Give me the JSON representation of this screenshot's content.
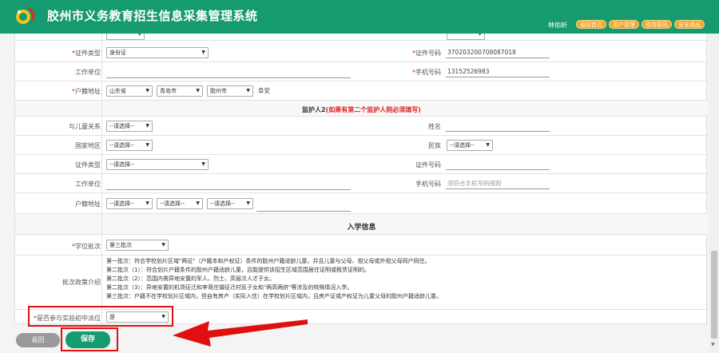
{
  "header": {
    "title": "胶州市义务教育招生信息采集管理系统",
    "user": "林佑昕",
    "links": [
      "返回首页",
      "用户管理",
      "修改密码",
      "安全退出"
    ]
  },
  "guardian1": {
    "row_top": {
      "left_label_partial": "",
      "right_label_partial": "",
      "left_value": "",
      "right_value": ""
    },
    "id_type_label": "证件类型",
    "id_type_value": "身份证",
    "id_number_label": "证件号码",
    "id_number_value": "370203200708087018",
    "work_unit_label": "工作单位",
    "phone_label": "手机号码",
    "phone_value": "13152526983",
    "hukou_label": "户籍地址",
    "hukou_province": "山东省",
    "hukou_city": "青岛市",
    "hukou_district": "胶州市",
    "hukou_detail": "阜安"
  },
  "guardian2": {
    "section_title": "监护人2",
    "section_note": "(如果有第二个监护人则必须填写)",
    "relation_label": "与儿童关系",
    "relation_value": "--请选择--",
    "name_label": "姓名",
    "country_label": "国家地区",
    "country_value": "--请选择--",
    "ethnic_label": "民族",
    "ethnic_value": "--请选择--",
    "id_type_label": "证件类型",
    "id_type_value": "--请选择--",
    "id_number_label": "证件号码",
    "work_unit_label": "工作单位",
    "phone_label": "手机号码",
    "phone_placeholder": "须符合手机号码规则",
    "hukou_label": "户籍地址",
    "hukou_province": "--请选择--",
    "hukou_city": "--请选择--",
    "hukou_district": "--请选择--"
  },
  "enrollment": {
    "section_title": "入学信息",
    "batch_label": "学位批次",
    "batch_value": "第三批次",
    "policy_label": "批次政策介绍",
    "policy_lines": [
      "第一批次：符合学校划片区域\"两证\"（户籍本和产权证）条件的胶州户籍适龄儿童，并且儿童与父母、祖父母或外祖父母同户同住。",
      "第二批次（1）：符合划片户籍条件的胶州户籍适龄儿童，且能提供该招生区域范围居住证明或租赁证明的。",
      "第二批次（2）：范围内需异地安置的军人、烈士、高层次人才子女。",
      "第二批次（3）：异地安置的机场征迁和李哥庄镇征迁村民子女和\"两高两挤\"等涉及的特殊情况入学。",
      "第三批次：户籍不在学校划片区域内，但自有房产（实际入住）在学校划片区域内，且房产证或产权证为儿童父母的胶州户籍适龄儿童。"
    ],
    "experiment_label": "是否参与实验初中派位",
    "experiment_value": "是"
  },
  "actions": {
    "back_label": "返回",
    "save_label": "保存"
  },
  "colors": {
    "header_green": "#159b6f",
    "link_orange": "#f5a524",
    "annotation_red": "#e01010"
  }
}
